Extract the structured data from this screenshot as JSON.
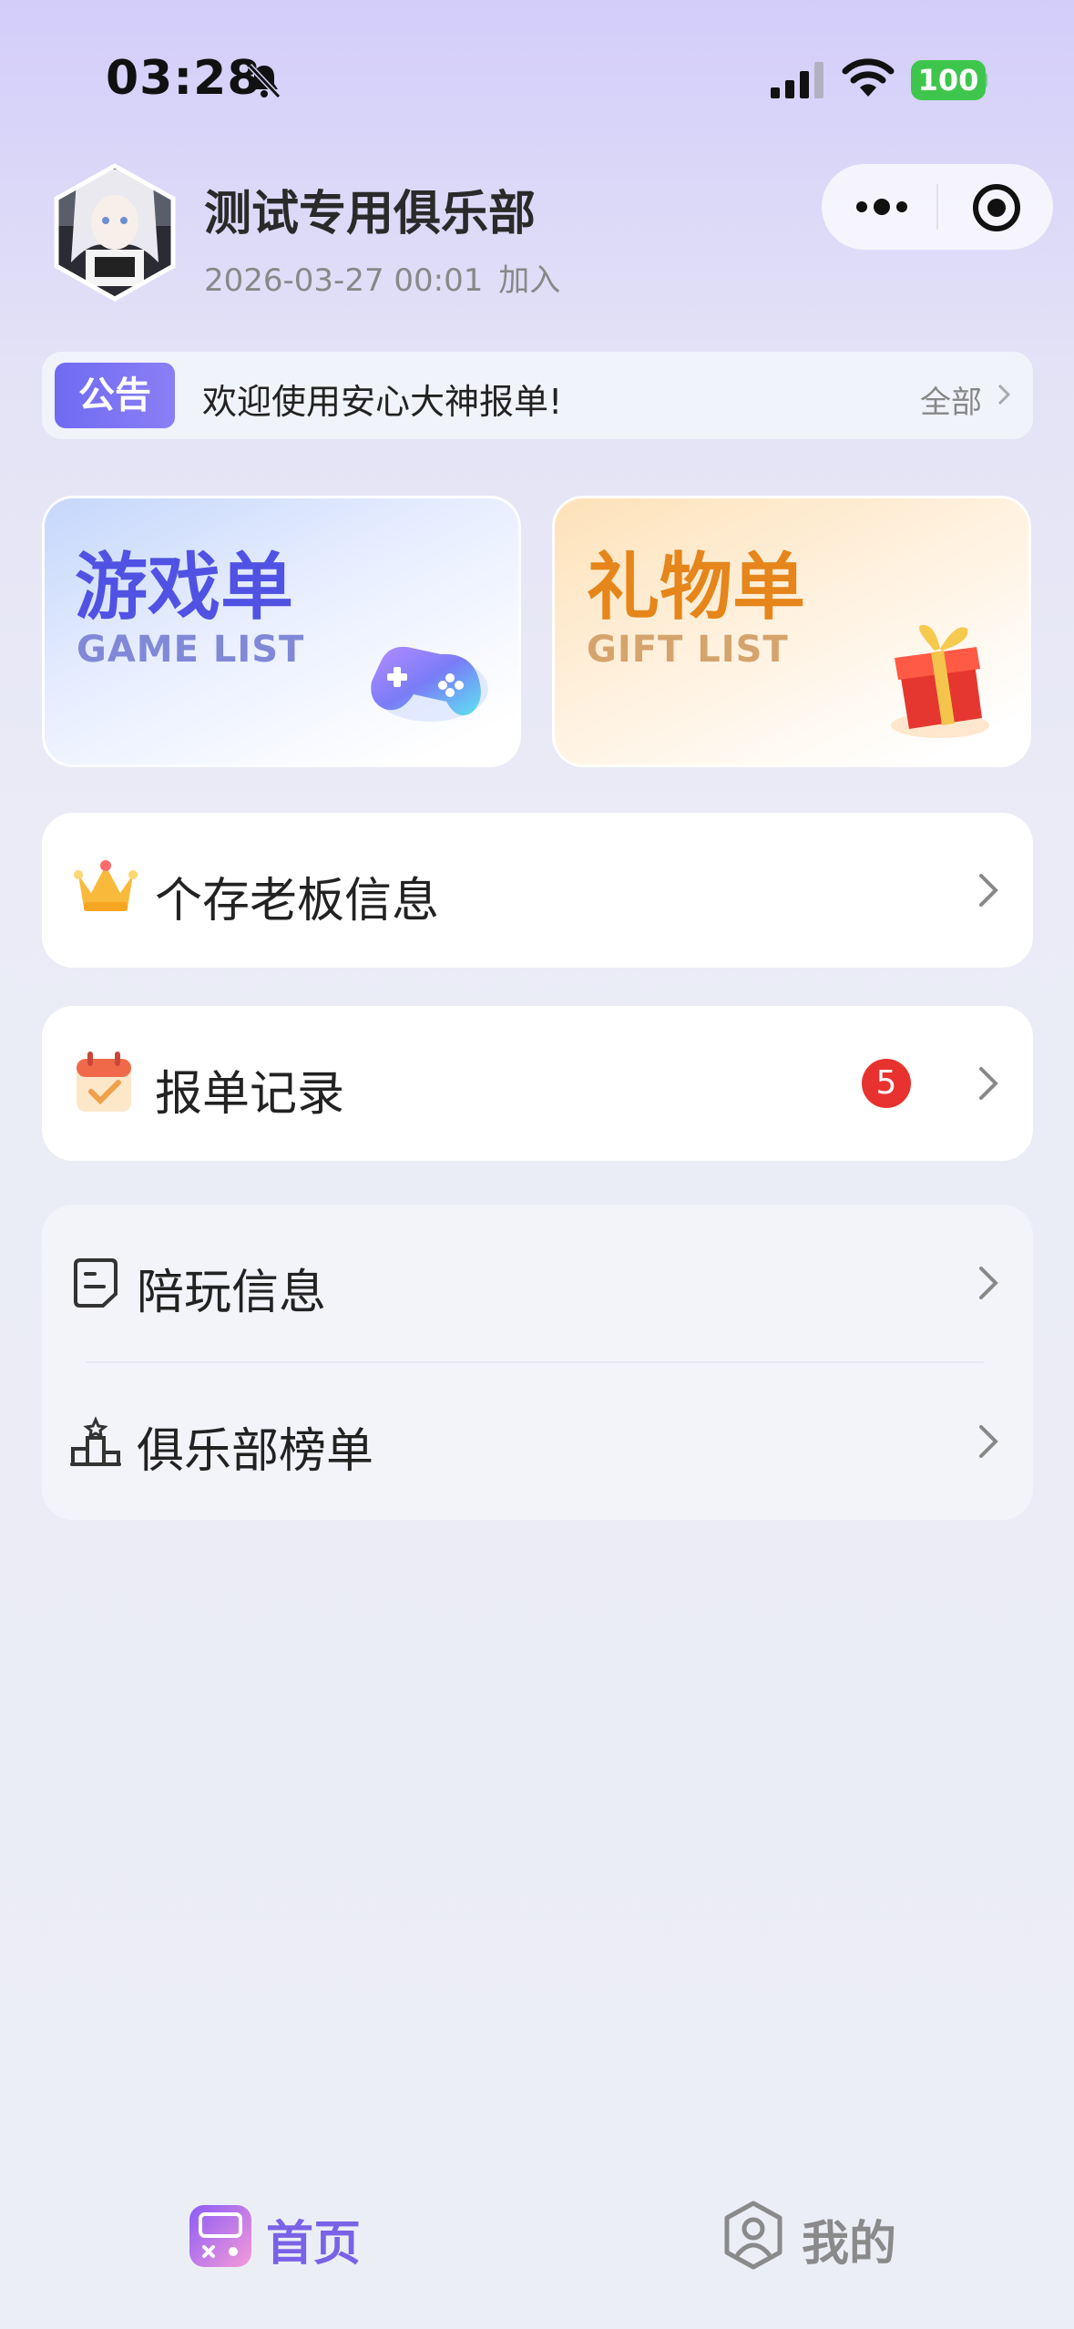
{
  "status_bar": {
    "time": "03:28",
    "battery": "100"
  },
  "header": {
    "club_name": "测试专用俱乐部",
    "join_date": "2026-03-27 00:01",
    "join_suffix": "加入"
  },
  "notice": {
    "tag": "公告",
    "text": "欢迎使用安心大神报单!",
    "all_label": "全部"
  },
  "cards": {
    "game": {
      "title": "游戏单",
      "subtitle": "GAME LIST"
    },
    "gift": {
      "title": "礼物单",
      "subtitle": "GIFT LIST"
    }
  },
  "menu": {
    "boss_info": "个存老板信息",
    "order_records": "报单记录",
    "order_badge": "5",
    "companion_info": "陪玩信息",
    "club_ranking": "俱乐部榜单"
  },
  "tabbar": {
    "home": "首页",
    "mine": "我的"
  },
  "colors": {
    "accent": "#7a62e6",
    "badge": "#e8322f",
    "gift_accent": "#e5851a",
    "game_accent": "#5052e3"
  }
}
